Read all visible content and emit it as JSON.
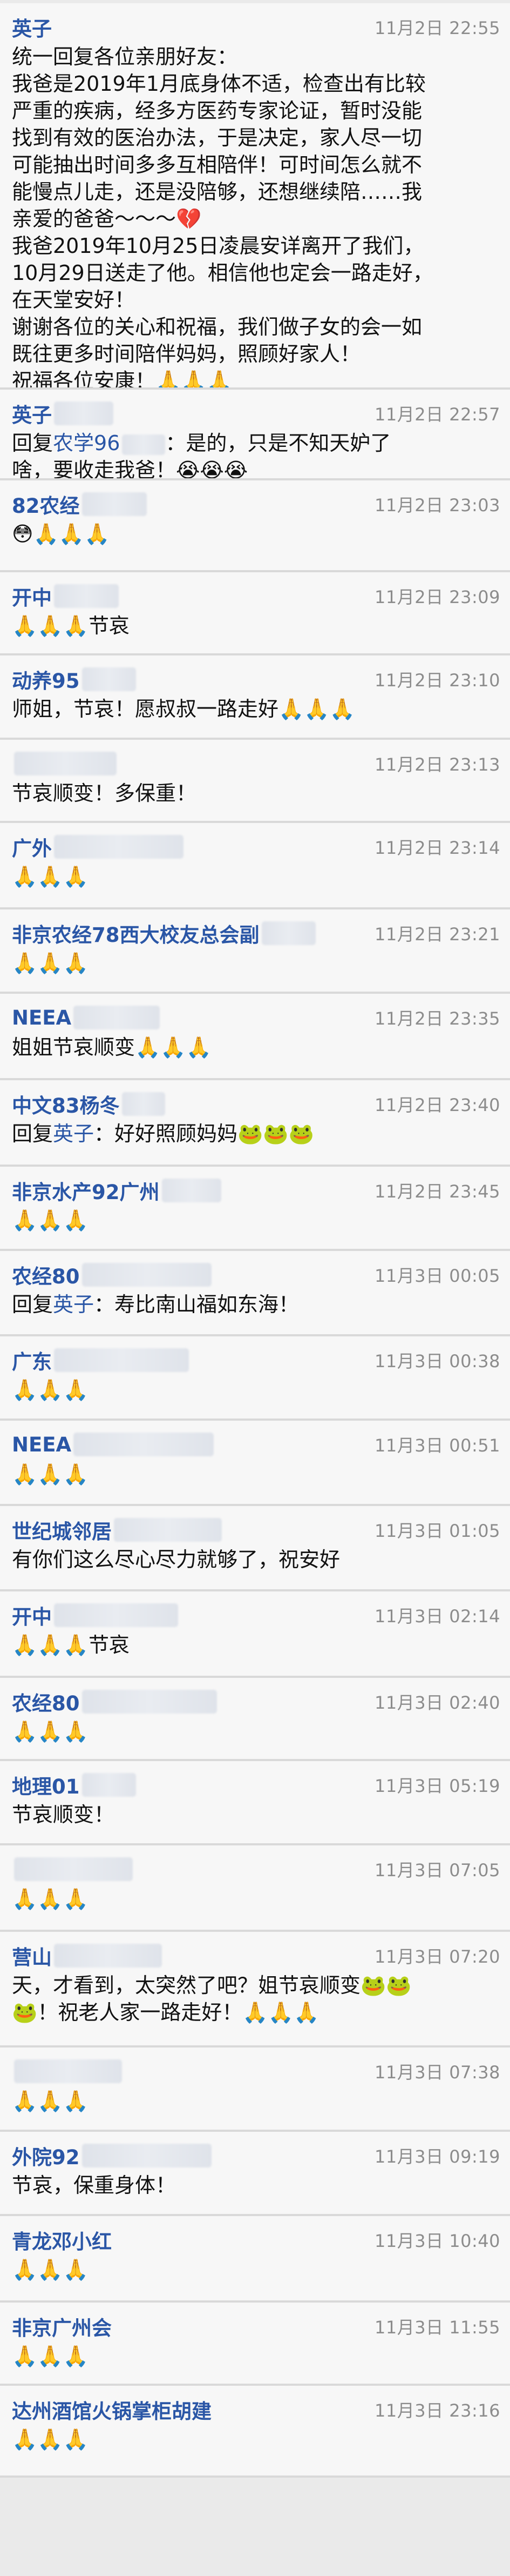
{
  "messages": [
    {
      "name": "英子",
      "redacted_width": 0,
      "time": "11月2日 22:55",
      "lines": [
        "统一回复各位亲朋好友：",
        "我爸是2019年1月底身体不适，检查出有比较",
        "严重的疾病，经多方医药专家论证，暂时没能",
        "找到有效的医治办法，于是决定，家人尽一切",
        "可能抽出时间多多互相陪伴！可时间怎么就不",
        "能慢点儿走，还是没陪够，还想继续陪……我",
        "亲爱的爸爸～～～💔",
        "我爸2019年10月25日凌晨安详离开了我们，",
        "10月29日送走了他。相信他也定会一路走好，",
        "在天堂安好！",
        "谢谢各位的关心和祝福，我们做子女的会一如",
        "既往更多时间陪伴妈妈，照顾好家人！",
        "祝福各位安康！🙏🙏🙏"
      ]
    },
    {
      "name": "英子",
      "time": "11月2日 22:57",
      "reply_prefix": "回复",
      "reply_to": "农学96",
      "lines": [
        "：是的，只是不知天妒了",
        "啥，要收走我爸！😭😭😭"
      ]
    },
    {
      "name": "82农经",
      "time": "11月2日 23:03",
      "emoji_line": "😳🙏🙏🙏"
    },
    {
      "name": "开中",
      "time": "11月2日 23:09",
      "lines": [
        "🙏🙏🙏节哀"
      ]
    },
    {
      "name": "动养95",
      "time": "11月2日 23:10",
      "lines": [
        "师姐，节哀！愿叔叔一路走好🙏🙏🙏"
      ]
    },
    {
      "name": "",
      "time": "11月2日 23:13",
      "lines": [
        "节哀顺变！多保重！"
      ]
    },
    {
      "name": "广外",
      "time": "11月2日 23:14",
      "emoji_line": "🙏🙏🙏"
    },
    {
      "name": "非京农经78西大校友总会副",
      "time": "11月2日 23:21",
      "emoji_line": "🙏🙏🙏"
    },
    {
      "name": "NEEA",
      "time": "11月2日 23:35",
      "lines": [
        "姐姐节哀顺变🙏🙏🙏"
      ]
    },
    {
      "name": "中文83杨冬",
      "time": "11月2日 23:40",
      "reply_prefix": "回复",
      "reply_to": "英子",
      "lines": [
        "：好好照顾妈妈🐸🐸🐸"
      ]
    },
    {
      "name": "非京水产92广州",
      "time": "11月2日 23:45",
      "emoji_line": "🙏🙏🙏"
    },
    {
      "name": "农经80",
      "time": "11月3日 00:05",
      "reply_prefix": "回复",
      "reply_to": "英子",
      "lines": [
        "：寿比南山福如东海！"
      ]
    },
    {
      "name": "广东",
      "time": "11月3日 00:38",
      "emoji_line": "🙏🙏🙏"
    },
    {
      "name": "NEEA",
      "time": "11月3日 00:51",
      "emoji_line": "🙏🙏🙏"
    },
    {
      "name": "世纪城邻居",
      "time": "11月3日 01:05",
      "lines": [
        "有你们这么尽心尽力就够了，祝安好"
      ]
    },
    {
      "name": "开中",
      "time": "11月3日 02:14",
      "lines": [
        "🙏🙏🙏节哀"
      ]
    },
    {
      "name": "农经80",
      "time": "11月3日 02:40",
      "emoji_line": "🙏🙏🙏"
    },
    {
      "name": "地理01",
      "time": "11月3日 05:19",
      "lines": [
        "节哀顺变！"
      ]
    },
    {
      "name": "",
      "time": "11月3日 07:05",
      "emoji_line": "🙏🙏🙏"
    },
    {
      "name": "营山",
      "time": "11月3日 07:20",
      "lines": [
        "天，才看到，太突然了吧？姐节哀顺变🐸🐸",
        "🐸！祝老人家一路走好！🙏🙏🙏"
      ]
    },
    {
      "name": "",
      "time": "11月3日 07:38",
      "emoji_line": "🙏🙏🙏"
    },
    {
      "name": "外院92",
      "time": "11月3日 09:19",
      "lines": [
        "节哀，保重身体！"
      ]
    },
    {
      "name": "青龙邓小红",
      "time": "11月3日 10:40",
      "emoji_line": "🙏🙏🙏"
    },
    {
      "name": "非京广州会",
      "time": "11月3日 11:55",
      "emoji_line": "🙏🙏🙏"
    },
    {
      "name": "达州酒馆火锅掌柜胡建",
      "time": "11月3日 23:16",
      "emoji_line": "🙏🙏🙏"
    }
  ],
  "colors": {
    "name": "#2a56a6",
    "time": "#8c8c8c",
    "card_bg": "#f7f7f7",
    "page_bg": "#eaeaea"
  }
}
